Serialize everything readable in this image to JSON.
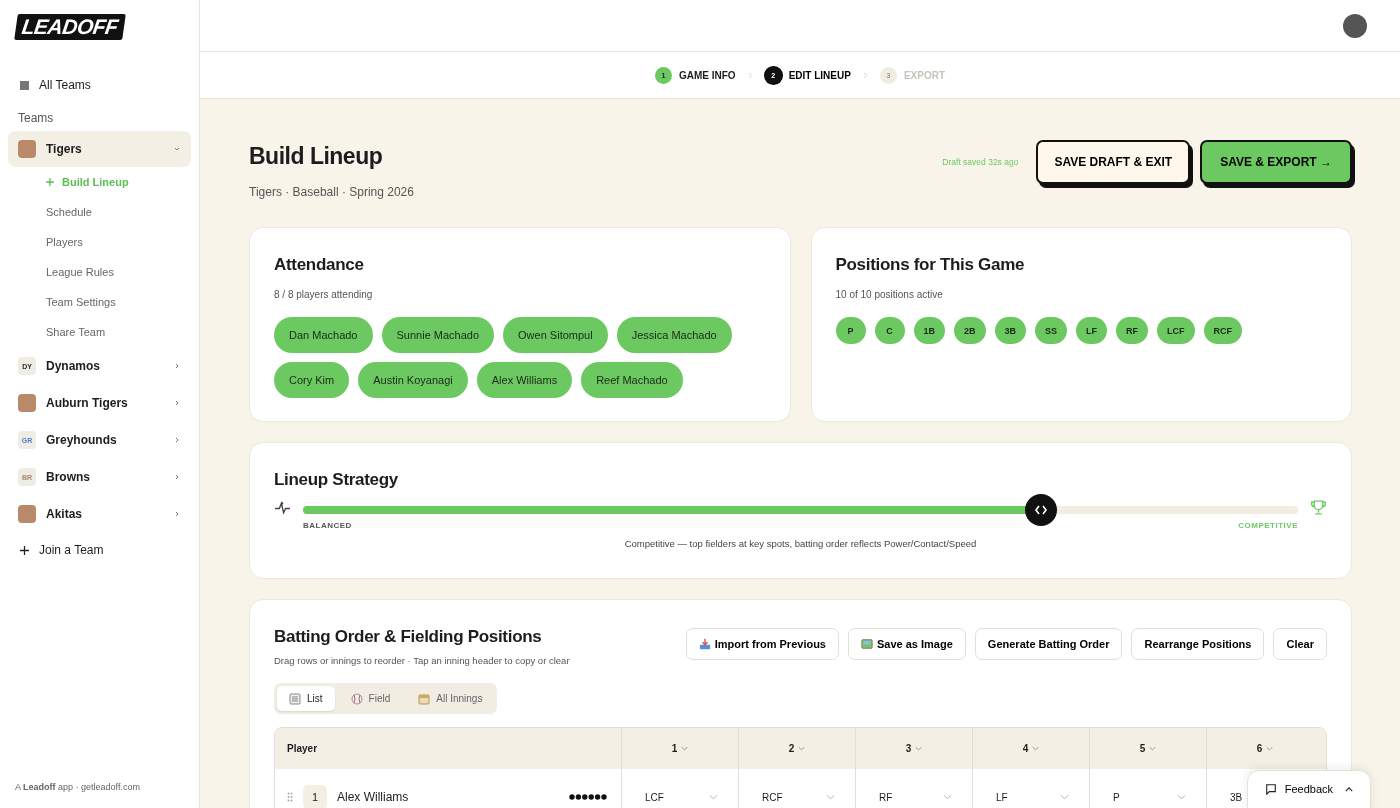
{
  "logo": "LEADOFF",
  "sidebar": {
    "all_teams": "All Teams",
    "section": "Teams",
    "teams": [
      {
        "name": "Tigers",
        "kind": "image",
        "expanded": true,
        "selected": true,
        "children": [
          {
            "label": "Build Lineup",
            "kind": "action"
          },
          {
            "label": "Schedule",
            "kind": "link"
          },
          {
            "label": "Players",
            "kind": "link"
          },
          {
            "label": "League Rules",
            "kind": "link"
          },
          {
            "label": "Team Settings",
            "kind": "link"
          },
          {
            "label": "Share Team",
            "kind": "link"
          }
        ]
      },
      {
        "name": "Dynamos",
        "kind": "initials",
        "badge": "DY",
        "color": "#2b2b2b",
        "expanded": false,
        "selected": false
      },
      {
        "name": "Auburn Tigers",
        "kind": "image",
        "expanded": false,
        "selected": false
      },
      {
        "name": "Greyhounds",
        "kind": "initials",
        "badge": "GR",
        "color": "#4a7fd6",
        "expanded": false,
        "selected": false
      },
      {
        "name": "Browns",
        "kind": "initials",
        "badge": "BR",
        "color": "#a88a6e",
        "expanded": false,
        "selected": false
      },
      {
        "name": "Akitas",
        "kind": "image",
        "expanded": false,
        "selected": false
      }
    ],
    "join": "Join a Team",
    "footer": "A **Leadoff** app · getleadoff.com"
  },
  "steps": [
    {
      "number": "1",
      "label": "GAME INFO",
      "done": true,
      "selected": false
    },
    {
      "number": "2",
      "label": "EDIT LINEUP",
      "done": false,
      "selected": true
    },
    {
      "number": "3",
      "label": "EXPORT",
      "done": false,
      "selected": false
    }
  ],
  "header": {
    "title": "Build Lineup",
    "subtitle": "Tigers · Baseball · Spring 2026",
    "draft_status": "Draft saved 32s ago",
    "secondary_button": "SAVE DRAFT & EXIT",
    "primary_button": "SAVE & EXPORT →"
  },
  "attendance": {
    "title": "Attendance",
    "summary": "8 / 8 players attending",
    "players": [
      {
        "name": "Dan Machado",
        "selected": true
      },
      {
        "name": "Sunnie Machado",
        "selected": true
      },
      {
        "name": "Owen Sitompul",
        "selected": true
      },
      {
        "name": "Jessica Machado",
        "selected": true
      },
      {
        "name": "Cory Kim",
        "selected": true
      },
      {
        "name": "Austin Koyanagi",
        "selected": true
      },
      {
        "name": "Alex Williams",
        "selected": true
      },
      {
        "name": "Reef Machado",
        "selected": true
      }
    ]
  },
  "positions": {
    "title": "Positions for This Game",
    "summary": "10 of 10 positions active",
    "items": [
      {
        "label": "P",
        "selected": true
      },
      {
        "label": "C",
        "selected": true
      },
      {
        "label": "1B",
        "selected": true
      },
      {
        "label": "2B",
        "selected": true
      },
      {
        "label": "3B",
        "selected": true
      },
      {
        "label": "SS",
        "selected": true
      },
      {
        "label": "LF",
        "selected": true
      },
      {
        "label": "RF",
        "selected": true
      },
      {
        "label": "LCF",
        "selected": true
      },
      {
        "label": "RCF",
        "selected": true
      }
    ]
  },
  "strategy": {
    "title": "Lineup Strategy",
    "left_label": "BALANCED",
    "right_label": "COMPETITIVE",
    "level": 0.742,
    "description": "Competitive — top fielders at key spots, batting order reflects Power/Contact/Speed"
  },
  "batting": {
    "title": "Batting Order & Fielding Positions",
    "hint": "Drag rows or innings to reorder · Tap an inning header to copy or clear",
    "actions": [
      {
        "label": "Import from Previous",
        "kind": "import"
      },
      {
        "label": "Save as Image",
        "kind": "image"
      },
      {
        "label": "Generate Batting Order",
        "kind": "plain"
      },
      {
        "label": "Rearrange Positions",
        "kind": "plain"
      },
      {
        "label": "Clear",
        "kind": "plain"
      }
    ],
    "views": [
      {
        "label": "List",
        "kind": "list",
        "selected": true
      },
      {
        "label": "Field",
        "kind": "field",
        "selected": false
      },
      {
        "label": "All Innings",
        "kind": "calendar",
        "selected": false
      }
    ],
    "columns": [
      "Player",
      "1",
      "2",
      "3",
      "4",
      "5",
      "6"
    ],
    "rows": [
      {
        "order": "1",
        "name": "Alex Williams",
        "cells": [
          "LCF",
          "RCF",
          "RF",
          "LF",
          "P",
          "3B"
        ]
      }
    ]
  },
  "feedback": "Feedback"
}
